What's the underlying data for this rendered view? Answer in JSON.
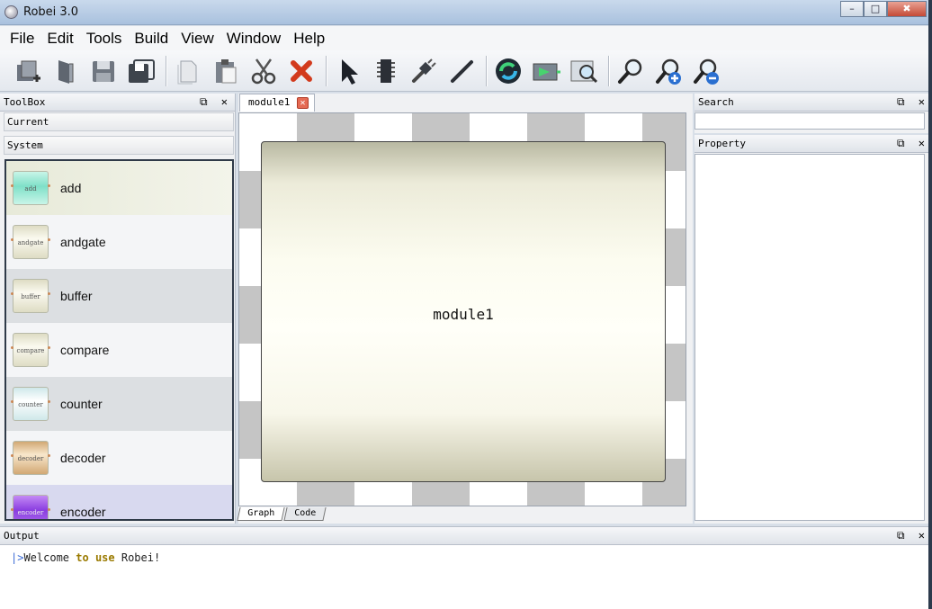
{
  "window": {
    "title": "Robei 3.0",
    "controls": [
      "–",
      "□",
      "✖"
    ]
  },
  "menu": [
    "File",
    "Edit",
    "Tools",
    "Build",
    "View",
    "Window",
    "Help"
  ],
  "toolbar": {
    "buttons": [
      "new-icon",
      "open-icon",
      "save-icon",
      "save-all-icon",
      "copy-icon",
      "paste-icon",
      "cut-icon",
      "delete-icon",
      "select-pointer-icon",
      "chip-icon",
      "wire-plug-icon",
      "line-icon",
      "build-icon",
      "simulate-icon",
      "waveform-icon",
      "zoom-icon",
      "zoom-in-icon",
      "zoom-out-icon"
    ]
  },
  "toolbox": {
    "title": "ToolBox",
    "categories": [
      "Current",
      "System"
    ],
    "components": [
      {
        "name": "add",
        "chip_label": "add",
        "color": "#7fe0c8"
      },
      {
        "name": "andgate",
        "chip_label": "andgate",
        "color": "#e8e6cf"
      },
      {
        "name": "buffer",
        "chip_label": "buffer",
        "color": "#ecebd3"
      },
      {
        "name": "compare",
        "chip_label": "compare",
        "color": "#e9e8d2"
      },
      {
        "name": "counter",
        "chip_label": "counter",
        "color": "#dff2f0"
      },
      {
        "name": "decoder",
        "chip_label": "decoder",
        "color": "#e3c8a0"
      },
      {
        "name": "encoder",
        "chip_label": "encoder",
        "color": "#9a52e0"
      }
    ]
  },
  "editor": {
    "tab_label": "module1",
    "module_label": "module1",
    "bottom_tabs": [
      "Graph",
      "Code"
    ]
  },
  "search": {
    "title": "Search",
    "placeholder": ""
  },
  "property": {
    "title": "Property"
  },
  "output": {
    "title": "Output",
    "line_prefix": "|>",
    "line_parts": [
      "Welcome",
      " to ",
      "use",
      " Robei!"
    ]
  },
  "panel_controls": "⧉ ✕"
}
